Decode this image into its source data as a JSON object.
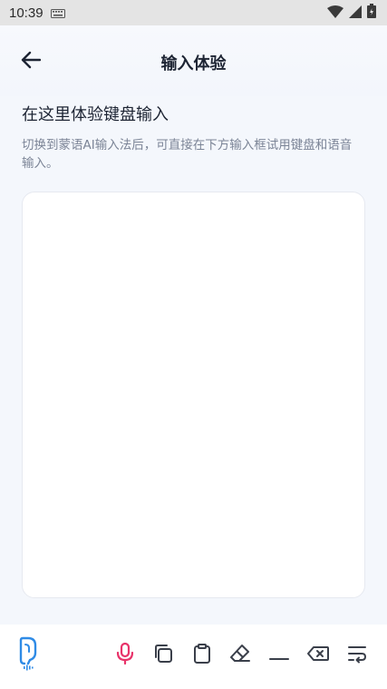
{
  "status_bar": {
    "time": "10:39"
  },
  "header": {
    "title": "输入体验"
  },
  "main": {
    "heading": "在这里体验键盘输入",
    "description": "切换到蒙语AI输入法后，可直接在下方输入框试用键盘和语音输入。",
    "input_value": ""
  },
  "toolbar": {
    "items": [
      "logo-icon",
      "microphone-icon",
      "copy-icon",
      "paste-icon",
      "eraser-icon",
      "space-icon",
      "backspace-icon",
      "newline-icon"
    ]
  },
  "colors": {
    "accent_blue": "#2f8be6",
    "mic_pink": "#e8336a",
    "icon_dark": "#3a3f4a",
    "background": "#f4f7fc"
  }
}
